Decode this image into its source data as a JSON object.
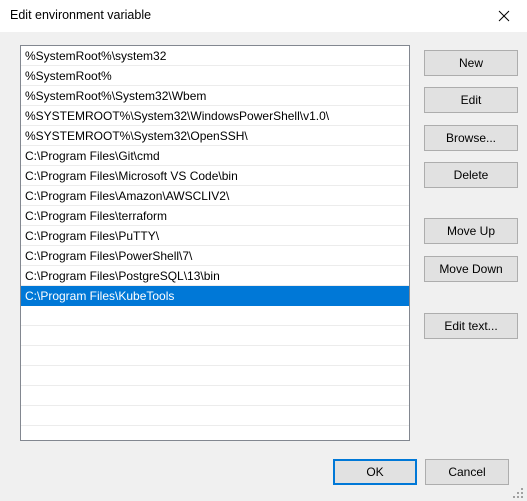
{
  "window": {
    "title": "Edit environment variable",
    "close_icon": "close-icon"
  },
  "path_list": {
    "entries": [
      "%SystemRoot%\\system32",
      "%SystemRoot%",
      "%SystemRoot%\\System32\\Wbem",
      "%SYSTEMROOT%\\System32\\WindowsPowerShell\\v1.0\\",
      "%SYSTEMROOT%\\System32\\OpenSSH\\",
      "C:\\Program Files\\Git\\cmd",
      "C:\\Program Files\\Microsoft VS Code\\bin",
      "C:\\Program Files\\Amazon\\AWSCLIV2\\",
      "C:\\Program Files\\terraform",
      "C:\\Program Files\\PuTTY\\",
      "C:\\Program Files\\PowerShell\\7\\",
      "C:\\Program Files\\PostgreSQL\\13\\bin",
      "C:\\Program Files\\KubeTools"
    ],
    "selected_index": 12,
    "empty_row_count": 7
  },
  "side_buttons": {
    "new": "New",
    "edit": "Edit",
    "browse": "Browse...",
    "delete": "Delete",
    "move_up": "Move Up",
    "move_down": "Move Down",
    "edit_text": "Edit text..."
  },
  "bottom_buttons": {
    "ok": "OK",
    "cancel": "Cancel"
  },
  "colors": {
    "selection_blue": "#0078d7",
    "dialog_background": "#f0f0f0",
    "button_face": "#e1e1e1",
    "listbox_border": "#828790"
  }
}
